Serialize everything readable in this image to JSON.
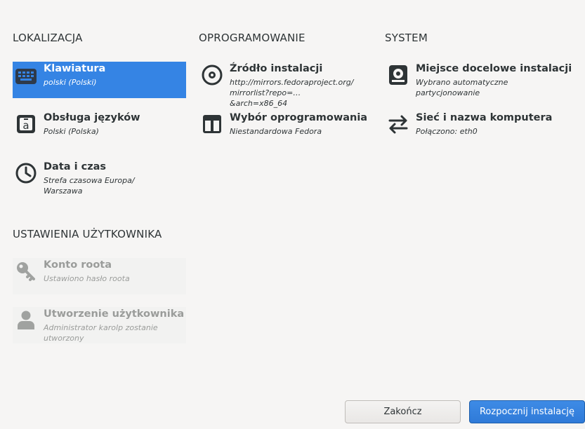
{
  "sections": {
    "localization": "LOKALIZACJA",
    "software": "OPROGRAMOWANIE",
    "system": "SYSTEM",
    "user_settings": "USTAWIENIA UŻYTKOWNIKA"
  },
  "spokes": {
    "keyboard": {
      "title": "Klawiatura",
      "status": "polski (Polski)",
      "icon": "keyboard-icon",
      "selected": true
    },
    "language": {
      "title": "Obsługa języków",
      "status": "Polski (Polska)",
      "icon": "language-icon"
    },
    "datetime": {
      "title": "Data i czas",
      "status": "Strefa czasowa Europa/ Warszawa",
      "icon": "clock-icon"
    },
    "source": {
      "title": "Źródło instalacji",
      "status": "http://mirrors.fedoraproject.org/ mirrorlist?repo=… &arch=x86_64",
      "icon": "disc-icon"
    },
    "software": {
      "title": "Wybór oprogramowania",
      "status": "Niestandardowa Fedora",
      "icon": "package-icon"
    },
    "destination": {
      "title": "Miejsce docelowe instalacji",
      "status": "Wybrano automatyczne partycjonowanie",
      "icon": "harddisk-icon"
    },
    "network": {
      "title": "Sieć i nazwa komputera",
      "status": "Połączono: eth0",
      "icon": "network-arrows-icon"
    },
    "root": {
      "title": "Konto roota",
      "status": "Ustawiono hasło roota",
      "icon": "key-icon",
      "disabled": true
    },
    "user": {
      "title": "Utworzenie użytkownika",
      "status": "Administrator karolp zostanie utworzony",
      "icon": "user-icon",
      "disabled": true
    }
  },
  "buttons": {
    "quit": "Zakończ",
    "begin": "Rozpocznij instalację"
  },
  "colors": {
    "accent": "#3584e4",
    "background": "#f6f5f4",
    "disabled_text": "#9a9c9a"
  }
}
